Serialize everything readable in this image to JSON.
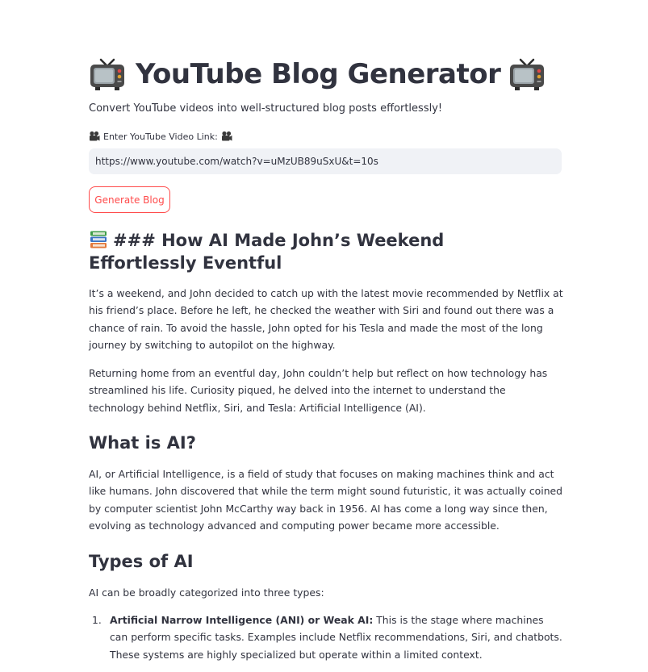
{
  "app": {
    "title": "YouTube Blog Generator",
    "subtitle": "Convert YouTube videos into well-structured blog posts effortlessly!",
    "accent_color": "#ff4b4b",
    "title_icon": "tv-icon"
  },
  "input": {
    "label": "Enter YouTube Video Link:",
    "label_icon": "camera-icon",
    "value": "https://www.youtube.com/watch?v=uMzUB89uSxU&t=10s"
  },
  "actions": {
    "generate_label": "Generate Blog"
  },
  "blog": {
    "heading_icon": "books-icon",
    "heading": "### How AI Made John’s Weekend Effortlessly Eventful",
    "paragraphs": [
      "It’s a weekend, and John decided to catch up with the latest movie recommended by Netflix at his friend’s place. Before he left, he checked the weather with Siri and found out there was a chance of rain. To avoid the hassle, John opted for his Tesla and made the most of the long journey by switching to autopilot on the highway.",
      "Returning home from an eventful day, John couldn’t help but reflect on how technology has streamlined his life. Curiosity piqued, he delved into the internet to understand the technology behind Netflix, Siri, and Tesla: Artificial Intelligence (AI)."
    ],
    "section_what": {
      "heading": "What is AI?",
      "paragraph": "AI, or Artificial Intelligence, is a field of study that focuses on making machines think and act like humans. John discovered that while the term might sound futuristic, it was actually coined by computer scientist John McCarthy way back in 1956. AI has come a long way since then, evolving as technology advanced and computing power became more accessible."
    },
    "section_types": {
      "heading": "Types of AI",
      "intro": "AI can be broadly categorized into three types:",
      "items": [
        {
          "number": "1.",
          "term": "Artificial Narrow Intelligence (ANI) or Weak AI:",
          "text": " This is the stage where machines can perform specific tasks. Examples include Netflix recommendations, Siri, and chatbots. These systems are highly specialized but operate within a limited context."
        }
      ]
    }
  }
}
